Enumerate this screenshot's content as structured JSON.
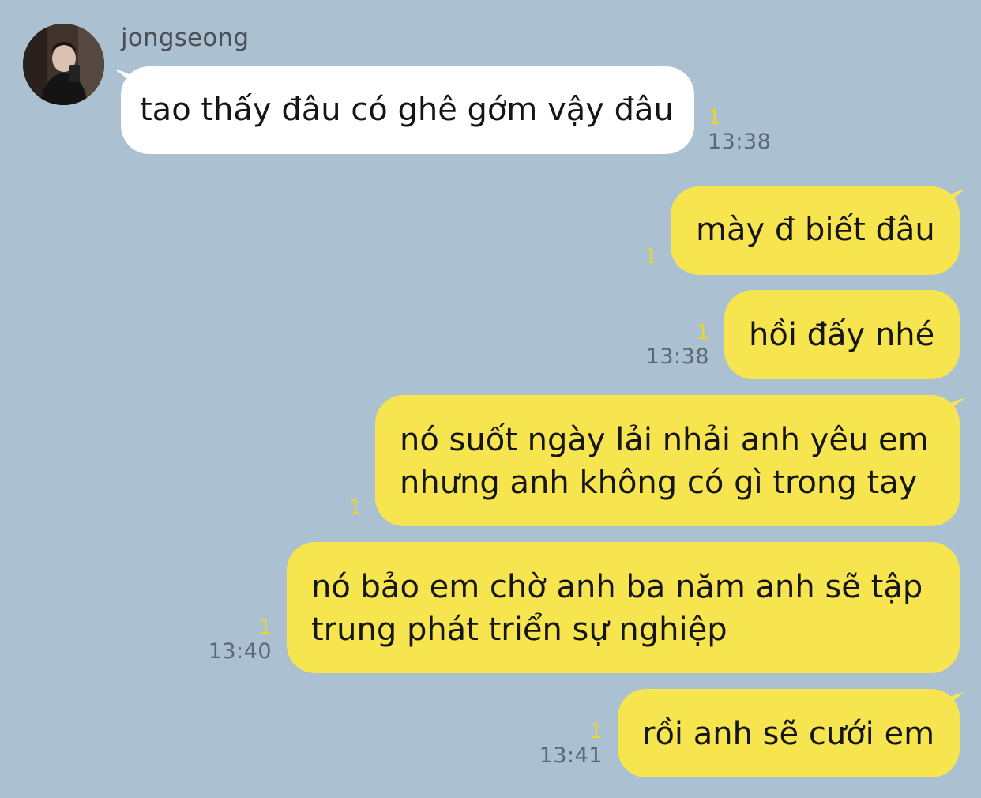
{
  "sender": {
    "name": "jongseong"
  },
  "messages": [
    {
      "text": "tao thấy đâu có ghê gớm vậy đâu",
      "unread": "1",
      "time": "13:38"
    },
    {
      "text": "mày đ biết đâu",
      "unread": "1",
      "time": ""
    },
    {
      "text": "hồi đấy nhé",
      "unread": "1",
      "time": "13:38"
    },
    {
      "line1": "nó suốt ngày lải nhải anh yêu em",
      "line2": "nhưng anh không có gì trong tay",
      "unread": "1",
      "time": ""
    },
    {
      "line1": "nó bảo em chờ anh ba năm anh sẽ tập",
      "line2": "trung phát triển sự nghiệp",
      "unread": "1",
      "time": "13:40"
    },
    {
      "text": "rồi anh sẽ cưới em",
      "unread": "1",
      "time": "13:41"
    }
  ],
  "colors": {
    "background": "#abc1d1",
    "incoming_bubble": "#ffffff",
    "outgoing_bubble": "#f7e54f",
    "unread_count": "#e8d530",
    "timestamp": "#5d6873"
  }
}
